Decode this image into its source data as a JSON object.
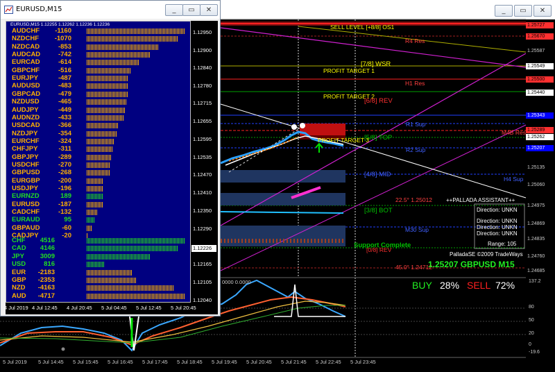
{
  "back_window": {
    "buttons": {
      "minimize": "_",
      "restore": "▭",
      "close": "✕"
    },
    "levels": [
      {
        "text": "SELL LEVEL [+8/8] OS1",
        "color": "#ffff00"
      },
      {
        "text": "R4 Res",
        "color": "#ff4040"
      },
      {
        "text": "[7/8] WSR",
        "color": "#ffff00"
      },
      {
        "text": "PROFIT TARGET 1",
        "color": "#ffff00"
      },
      {
        "text": "H1 Res",
        "color": "#ff4040"
      },
      {
        "text": "PROFIT TARGET 2",
        "color": "#ffff00"
      },
      {
        "text": "[6/8] REV",
        "color": "#ff3030"
      },
      {
        "text": "R1 Sup",
        "color": "#4060ff"
      },
      {
        "text": "M4B Res",
        "color": "#ff4040"
      },
      {
        "text": "[5/8] TOP",
        "color": "#00c000"
      },
      {
        "text": "PROFIT TARGET 3",
        "color": "#ffff00"
      },
      {
        "text": "R2 Sup",
        "color": "#4060ff"
      },
      {
        "text": "[4/8] MID",
        "color": "#4060ff"
      },
      {
        "text": "H4 Sup",
        "color": "#4060ff"
      },
      {
        "text": "22.5° 1.25012",
        "color": "#ff4040"
      },
      {
        "text": "[3/8] BOT",
        "color": "#00c000"
      },
      {
        "text": "M30 Sup",
        "color": "#4060ff"
      },
      {
        "text": "Support Complete",
        "color": "#00c000"
      },
      {
        "text": "[0/8] REV",
        "color": "#ff3030"
      },
      {
        "text": "45.0° 1.24712",
        "color": "#ff4040"
      }
    ],
    "price_labels": [
      {
        "text": "1.25727",
        "bg": "#ff3030",
        "fg": "#000"
      },
      {
        "text": "1.25670",
        "bg": "#ff3030",
        "fg": "#000"
      },
      {
        "text": "1.25587",
        "bg": "#000",
        "fg": "#ccc"
      },
      {
        "text": "1.25549",
        "bg": "#fff",
        "fg": "#000"
      },
      {
        "text": "1.25500",
        "bg": "#ff3030",
        "fg": "#000"
      },
      {
        "text": "1.25440",
        "bg": "#fff",
        "fg": "#000"
      },
      {
        "text": "1.25343",
        "bg": "#0000ff",
        "fg": "#fff"
      },
      {
        "text": "1.25289",
        "bg": "#ff3030",
        "fg": "#000"
      },
      {
        "text": "1.25262",
        "bg": "#fff",
        "fg": "#000"
      },
      {
        "text": "1.25207",
        "bg": "#0000ff",
        "fg": "#fff"
      },
      {
        "text": "1.25135",
        "bg": "#000",
        "fg": "#ccc"
      },
      {
        "text": "1.25060",
        "bg": "#000",
        "fg": "#ccc"
      },
      {
        "text": "1.24975",
        "bg": "#000",
        "fg": "#ccc"
      },
      {
        "text": "1.24869",
        "bg": "#000",
        "fg": "#ccc"
      },
      {
        "text": "1.24835",
        "bg": "#000",
        "fg": "#ccc"
      },
      {
        "text": "1.24760",
        "bg": "#000",
        "fg": "#ccc"
      },
      {
        "text": "1.24685",
        "bg": "#000",
        "fg": "#ccc"
      }
    ],
    "assistant": {
      "title": "++PALLADA ASSISTANT++",
      "direction": "Direction: UNKN",
      "directions": [
        "Direction: UNKN",
        "Direction: UNKN",
        "Direction: UNKN"
      ],
      "range": "Range: 105",
      "copyright": "PalladaSE ©2009 TradeWays",
      "quote": "1.25207 GBPUSD M15",
      "buy_label": "BUY",
      "buy_pct": "28%",
      "sell_label": "SELL",
      "sell_pct": "72%"
    },
    "osc_header": "0000 0.0000",
    "osc_scale": [
      "137.2",
      "80",
      "50",
      "20",
      "0",
      "-19.6"
    ],
    "time_labels": [
      "5 Jul 2019",
      "5 Jul 14:45",
      "5 Jul 15:45",
      "5 Jul 16:45",
      "5 Jul 17:45",
      "5 Jul 18:45",
      "5 Jul 19:45",
      "5 Jul 20:45",
      "5 Jul 21:45",
      "5 Jul 22:45",
      "5 Jul 23:45"
    ]
  },
  "strength_window": {
    "title": "EURUSD,M15",
    "header": "EURUSD,M15 1.12255 1.12262 1.12236 1.12236",
    "buttons": {
      "minimize": "_",
      "restore": "▭",
      "close": "✕"
    },
    "pairs": [
      {
        "name": "AUDCHF",
        "value": "-1160",
        "strength": 1160,
        "color": "#ffb000"
      },
      {
        "name": "NZDCHF",
        "value": "-1070",
        "strength": 1070,
        "color": "#ffb000"
      },
      {
        "name": "NZDCAD",
        "value": "-853",
        "strength": 853,
        "color": "#ffb000"
      },
      {
        "name": "AUDCAD",
        "value": "-742",
        "strength": 742,
        "color": "#ffb000"
      },
      {
        "name": "EURCAD",
        "value": "-614",
        "strength": 614,
        "color": "#ffb000"
      },
      {
        "name": "GBPCHF",
        "value": "-516",
        "strength": 516,
        "color": "#ffb000"
      },
      {
        "name": "EURJPY",
        "value": "-487",
        "strength": 487,
        "color": "#ffb000"
      },
      {
        "name": "AUDUSD",
        "value": "-483",
        "strength": 483,
        "color": "#ffb000"
      },
      {
        "name": "GBPCAD",
        "value": "-479",
        "strength": 479,
        "color": "#ffb000"
      },
      {
        "name": "NZDUSD",
        "value": "-465",
        "strength": 465,
        "color": "#ffb000"
      },
      {
        "name": "AUDJPY",
        "value": "-449",
        "strength": 449,
        "color": "#ffb000"
      },
      {
        "name": "AUDNZD",
        "value": "-433",
        "strength": 433,
        "color": "#ffb000"
      },
      {
        "name": "USDCAD",
        "value": "-366",
        "strength": 366,
        "color": "#ffb000"
      },
      {
        "name": "NZDJPY",
        "value": "-354",
        "strength": 354,
        "color": "#ffb000"
      },
      {
        "name": "EURCHF",
        "value": "-324",
        "strength": 324,
        "color": "#ffb000"
      },
      {
        "name": "CHFJPY",
        "value": "-311",
        "strength": 311,
        "color": "#ffb000"
      },
      {
        "name": "GBPJPY",
        "value": "-289",
        "strength": 289,
        "color": "#ffb000"
      },
      {
        "name": "USDCHF",
        "value": "-270",
        "strength": 270,
        "color": "#ffb000"
      },
      {
        "name": "GBPUSD",
        "value": "-268",
        "strength": 268,
        "color": "#ffb000"
      },
      {
        "name": "EURGBP",
        "value": "-200",
        "strength": 200,
        "color": "#ffb000"
      },
      {
        "name": "USDJPY",
        "value": "-196",
        "strength": 196,
        "color": "#ffb000"
      },
      {
        "name": "EURNZD",
        "value": "189",
        "strength": 189,
        "color": "#22dd22"
      },
      {
        "name": "EURUSD",
        "value": "-187",
        "strength": 187,
        "color": "#ffb000"
      },
      {
        "name": "CADCHF",
        "value": "-132",
        "strength": 132,
        "color": "#ffb000"
      },
      {
        "name": "EURAUD",
        "value": "95",
        "strength": 95,
        "color": "#22dd22"
      },
      {
        "name": "GBPAUD",
        "value": "-60",
        "strength": 60,
        "color": "#ffb000"
      },
      {
        "name": "CADJPY",
        "value": "-20",
        "strength": 20,
        "color": "#ffb000"
      }
    ],
    "currencies": [
      {
        "name": "CHF",
        "value": "4516",
        "strength": 4716,
        "color": "#22dd22"
      },
      {
        "name": "CAD",
        "value": "4146",
        "strength": 4356,
        "color": "#22dd22"
      },
      {
        "name": "JPY",
        "value": "3009",
        "strength": 3009,
        "color": "#22dd22"
      },
      {
        "name": "USD",
        "value": "816",
        "strength": 816,
        "color": "#22dd22"
      },
      {
        "name": "EUR",
        "value": "-2183",
        "strength": 2183,
        "color": "#ffb000"
      },
      {
        "name": "GBP",
        "value": "-2353",
        "strength": 2353,
        "color": "#ffb000"
      },
      {
        "name": "NZD",
        "value": "-4163",
        "strength": 4163,
        "color": "#ffb000"
      },
      {
        "name": "AUD",
        "value": "-4717",
        "strength": 4717,
        "color": "#ffb000"
      }
    ],
    "price_axis": [
      "1.12950",
      "1.12900",
      "1.12840",
      "1.12780",
      "1.12715",
      "1.12655",
      "1.12595",
      "1.12535",
      "1.12470",
      "1.12410",
      "1.12350",
      "1.12290",
      "1.12165",
      "1.12105",
      "1.12040"
    ],
    "current_price": "1.12226",
    "dates": [
      "4 Jul 2019",
      "4 Jul 12:45",
      "4 Jul 20:45",
      "5 Jul 04:45",
      "5 Jul 12:45",
      "5 Jul 20:45"
    ]
  }
}
